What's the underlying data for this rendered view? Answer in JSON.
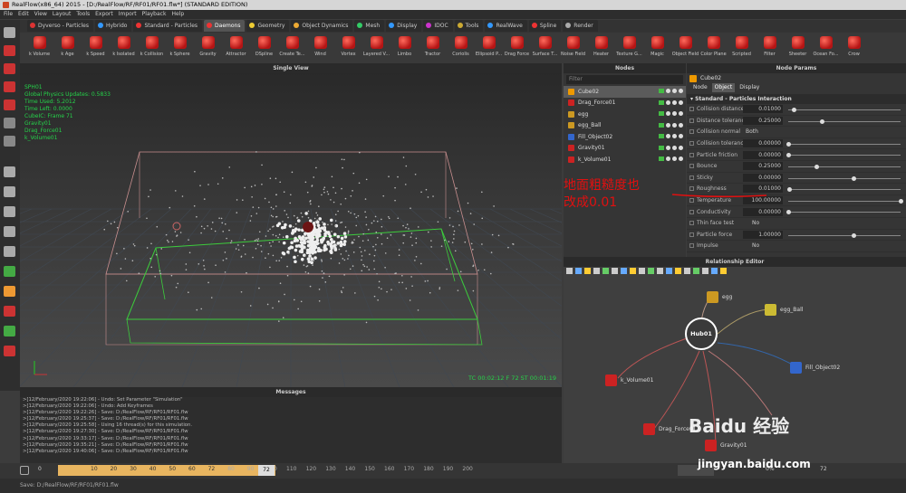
{
  "window": {
    "title": "RealFlow(x86_64) 2015 - [D:/RealFlow/RF/RF01/RF01.flw*] (STANDARD EDITION)"
  },
  "menu": [
    "File",
    "Edit",
    "View",
    "Layout",
    "Tools",
    "Export",
    "Import",
    "Playback",
    "Help"
  ],
  "tabs": [
    {
      "label": "Dyverso - Particles",
      "color": "#d33"
    },
    {
      "label": "Hybrido",
      "color": "#39f"
    },
    {
      "label": "Standard - Particles",
      "color": "#e33"
    },
    {
      "label": "Daemons",
      "color": "#e33"
    },
    {
      "label": "Geometry",
      "color": "#ec3"
    },
    {
      "label": "Object Dynamics",
      "color": "#ea3"
    },
    {
      "label": "Mesh",
      "color": "#3c6"
    },
    {
      "label": "Display",
      "color": "#39f"
    },
    {
      "label": "IDOC",
      "color": "#c3c"
    },
    {
      "label": "Tools",
      "color": "#ca3"
    },
    {
      "label": "RealWave",
      "color": "#39f"
    },
    {
      "label": "Spline",
      "color": "#e33"
    },
    {
      "label": "Render",
      "color": "#aaa"
    }
  ],
  "daemons": [
    "k Volume",
    "k Age",
    "k Speed",
    "k Isolated",
    "k Collision",
    "k Sphere",
    "Gravity",
    "Attractor",
    "DSpline",
    "Create Te...",
    "Wind",
    "Vortex",
    "Layered V...",
    "Limbo",
    "Tractor",
    "Coriolis",
    "Ellipsoid P...",
    "Drag Force",
    "Surface T...",
    "Noise Field",
    "Heater",
    "Texture G...",
    "Magic",
    "Object Field",
    "Color Plane",
    "Scripted",
    "Filter",
    "Sheeter",
    "Ocean Fo...",
    "Crow"
  ],
  "viewport": {
    "title": "Single View",
    "info": [
      "SPH01",
      "Global Physics Updates: 0.5833",
      "Time Used: 5.2012",
      "Time Left: 0.0000",
      "CubeIC: Frame 71",
      "Gravity01",
      "Drag_Force01",
      "k_Volume01"
    ],
    "status": "TC 00:02:12   F 72   ST 00:01:19"
  },
  "nodes": {
    "title": "Nodes",
    "filter": "Filter",
    "items": [
      {
        "label": "Cube02",
        "color": "#e90",
        "selected": true
      },
      {
        "label": "Drag_Force01",
        "color": "#c22"
      },
      {
        "label": "egg",
        "color": "#c92"
      },
      {
        "label": "egg_Ball",
        "color": "#c92"
      },
      {
        "label": "Fill_Object02",
        "color": "#36c"
      },
      {
        "label": "Gravity01",
        "color": "#c22"
      },
      {
        "label": "k_Volume01",
        "color": "#c22"
      }
    ]
  },
  "node_params": {
    "title": "Node Params",
    "object_name": "Cube02",
    "tabs": [
      "Node",
      "Object",
      "Display"
    ],
    "active_tab": "Object",
    "section": "Standard - Particles Interaction",
    "params": [
      {
        "label": "Collision distance",
        "value": "0.01000",
        "knob": 0.05
      },
      {
        "label": "Distance tolerance",
        "value": "0.25000",
        "knob": 0.3
      },
      {
        "label": "Collision normal",
        "value": "Both",
        "dropdown": true
      },
      {
        "label": "Collision tolerance",
        "value": "0.00000",
        "knob": 0
      },
      {
        "label": "Particle friction",
        "value": "0.00000",
        "knob": 0
      },
      {
        "label": "Bounce",
        "value": "0.25000",
        "knob": 0.25
      },
      {
        "label": "Sticky",
        "value": "0.00000",
        "knob": 0.58
      },
      {
        "label": "Roughness",
        "value": "0.01000",
        "knob": 0.01
      },
      {
        "label": "Temperature",
        "value": "100.00000",
        "knob": 1
      },
      {
        "label": "Conductivity",
        "value": "0.00000",
        "knob": 0
      },
      {
        "label": "Thin face test",
        "value": "No",
        "toggle": true
      },
      {
        "label": "Particle force",
        "value": "1.00000",
        "knob": 0.58
      },
      {
        "label": "Impulse",
        "value": "No",
        "toggle": true
      }
    ]
  },
  "annotation": {
    "line1": "地面粗糙度也",
    "line2": "改成0.01"
  },
  "relation": {
    "title": "Relationship Editor",
    "hub": "Hub01",
    "nodes": [
      {
        "label": "egg",
        "color": "#c92"
      },
      {
        "label": "egg_Ball",
        "color": "#cb3"
      },
      {
        "label": "Fill_Object02",
        "color": "#36c"
      },
      {
        "label": "k_Volume01",
        "color": "#c22"
      },
      {
        "label": "Drag_Force01",
        "color": "#c22"
      },
      {
        "label": "Gravity01",
        "color": "#c22"
      }
    ]
  },
  "messages": {
    "title": "Messages",
    "lines": [
      ">[12/February/2020 19:22:06] - Undo: Set Parameter \"Simulation\"",
      ">[12/February/2020 19:22:06] - Undo: Add Keyframes",
      ">[12/February/2020 19:22:26] - Save: D:/RealFlow/RF/RF01/RF01.flw",
      ">[12/February/2020 19:25:37] - Save: D:/RealFlow/RF/RF01/RF01.flw",
      ">[12/February/2020 19:25:58] - Using 16 thread(s) for this simulation.",
      ">[12/February/2020 19:27:30] - Save: D:/RealFlow/RF/RF01/RF01.flw",
      ">[12/February/2020 19:33:17] - Save: D:/RealFlow/RF/RF01/RF01.flw",
      ">[12/February/2020 19:35:21] - Save: D:/RealFlow/RF/RF01/RF01.flw",
      ">[12/February/2020 19:40:06] - Save: D:/RealFlow/RF/RF01/RF01.flw"
    ]
  },
  "timeline": {
    "start": "0",
    "ticks": [
      "10",
      "20",
      "30",
      "40",
      "50",
      "60",
      "72",
      "80",
      "90",
      "100",
      "110",
      "120",
      "130",
      "140",
      "150",
      "160",
      "170",
      "180",
      "190",
      "200"
    ],
    "current": "72",
    "end": "200",
    "sim_frame": "72",
    "zoom": "0%"
  },
  "status": "Save: D:/RealFlow/RF/RF01/RF01.flw",
  "watermark": {
    "brand": "Baidu 经验",
    "url": "jingyan.baidu.com"
  }
}
